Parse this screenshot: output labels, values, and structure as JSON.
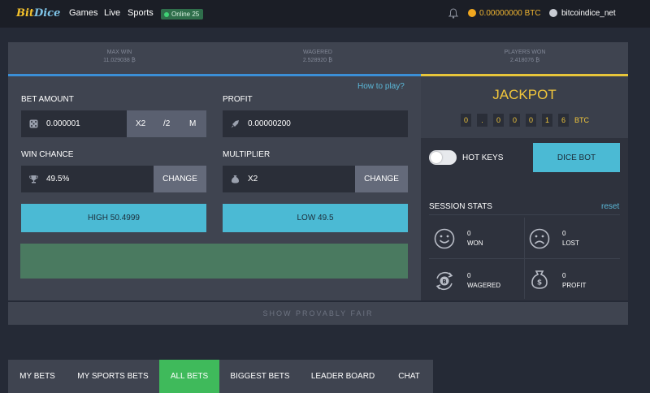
{
  "header": {
    "logo_prefix": "Bit",
    "logo_suffix": "Dice",
    "nav": [
      "Games",
      "Live",
      "Sports"
    ],
    "online": "Online 25",
    "balance": "0.00000000 BTC",
    "username": "bitcoindice_net"
  },
  "stats": {
    "max_win_label": "MAX WIN",
    "max_win_value": "11.029038 ₿",
    "wagered_label": "WAGERED",
    "wagered_value": "2.528920 ₿",
    "players_won_label": "PLAYERS WON",
    "players_won_value": "2.418076 ₿"
  },
  "game": {
    "how_to_play": "How to play?",
    "bet_amount_label": "BET AMOUNT",
    "bet_amount_value": "0.000001",
    "bet_x2": "X2",
    "bet_half": "/2",
    "bet_max": "M",
    "profit_label": "PROFIT",
    "profit_value": "0.00000200",
    "win_chance_label": "WIN CHANCE",
    "win_chance_value": "49.5%",
    "change_label": "CHANGE",
    "multiplier_label": "MULTIPLIER",
    "multiplier_value": "X2",
    "high_button": "HIGH 50.4999",
    "low_button": "LOW 49.5"
  },
  "jackpot": {
    "title": "JACKPOT",
    "digits": [
      "0",
      ".",
      "0",
      "0",
      "0",
      "1",
      "6",
      "6"
    ],
    "unit": "BTC"
  },
  "controls": {
    "hot_keys_label": "HOT KEYS",
    "hot_keys_on": false,
    "dice_bot": "DICE BOT"
  },
  "session": {
    "title": "SESSION STATS",
    "reset": "reset",
    "won_value": "0",
    "won_label": "WON",
    "lost_value": "0",
    "lost_label": "LOST",
    "wagered_value": "0",
    "wagered_label": "WAGERED",
    "profit_value": "0",
    "profit_label": "PROFIT"
  },
  "provably_fair": "SHOW PROVABLY FAIR",
  "tabs": [
    "MY BETS",
    "MY SPORTS BETS",
    "ALL BETS",
    "BIGGEST BETS",
    "LEADER BOARD",
    "CHAT"
  ],
  "active_tab": "ALL BETS",
  "colors": {
    "accent": "#4bbad4",
    "active_tab": "#3fba5b",
    "jackpot": "#f1c63b",
    "balance": "#f0b531"
  }
}
